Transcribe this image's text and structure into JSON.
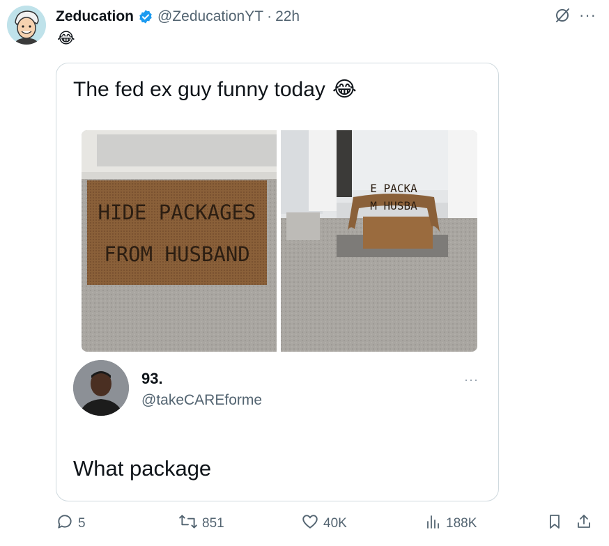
{
  "post": {
    "display_name": "Zeducation",
    "handle": "@ZeducationYT",
    "separator": "·",
    "time": "22h",
    "body_emoji": "😂"
  },
  "quote": {
    "text": "The fed ex guy funny today",
    "text_emoji": "😂",
    "images": [
      {
        "mat_text_line1": "HIDE PACKAGES",
        "mat_text_line2": "FROM HUSBAND"
      },
      {
        "mat_text_line1": "E PACKA",
        "mat_text_line2": "M HUSBA"
      }
    ],
    "reply": {
      "display_name": "93.",
      "handle": "@takeCAREforme",
      "text": "What package"
    }
  },
  "actions": {
    "replies": "5",
    "reposts": "851",
    "likes": "40K",
    "views": "188K"
  },
  "icons": {
    "verified": "verified-badge-icon",
    "grok": "grok-icon",
    "more": "more-icon",
    "reply": "reply-icon",
    "repost": "repost-icon",
    "like": "heart-icon",
    "views": "views-icon",
    "bookmark": "bookmark-icon",
    "share": "share-icon"
  },
  "colors": {
    "verified_blue": "#1d9bf0",
    "muted_text": "#536471",
    "border": "#cfd9de"
  }
}
